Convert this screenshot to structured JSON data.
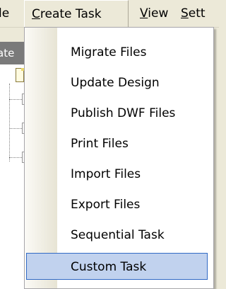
{
  "menubar": {
    "file_label_visible": "le",
    "create_task_label": "Create Task",
    "view_label": "View",
    "settings_label_visible": "Sett"
  },
  "background": {
    "header_text_visible": "ate"
  },
  "dropdown": {
    "items": [
      {
        "label": "Migrate Files"
      },
      {
        "label": "Update Design"
      },
      {
        "label": "Publish DWF Files"
      },
      {
        "label": "Print Files"
      },
      {
        "label": "Import Files"
      },
      {
        "label": "Export Files"
      },
      {
        "label": "Sequential Task"
      },
      {
        "label": "Custom Task"
      }
    ],
    "selected_label": "Custom Task"
  },
  "colors": {
    "menu_background": "#ece9d8",
    "selection_fill": "#c1d2ee",
    "selection_border": "#316ac5"
  }
}
